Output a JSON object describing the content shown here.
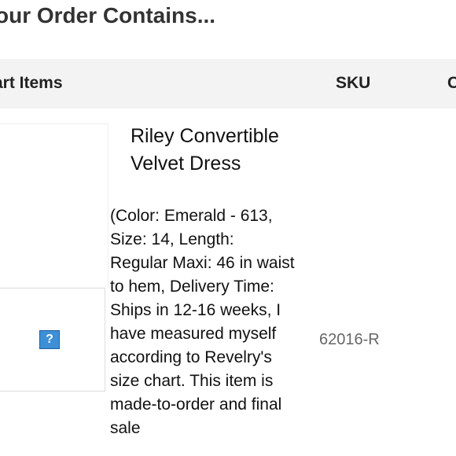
{
  "page": {
    "title": "our Order Contains..."
  },
  "table": {
    "headers": {
      "items": "art Items",
      "sku": "SKU",
      "cut": "C"
    },
    "rows": [
      {
        "thumbnail_icon": "broken-image-question-icon",
        "thumbnail_glyph": "?",
        "product_name": "Riley Convertible Velvet Dress",
        "description": "(Color: Emerald - 613, Size: 14, Length: Regular Maxi: 46 in waist to hem, Delivery Time: Ships in 12-16 weeks, I have measured myself according to Revelry's size chart. This item is made-to-order and final sale",
        "sku": "62016-R"
      }
    ]
  }
}
